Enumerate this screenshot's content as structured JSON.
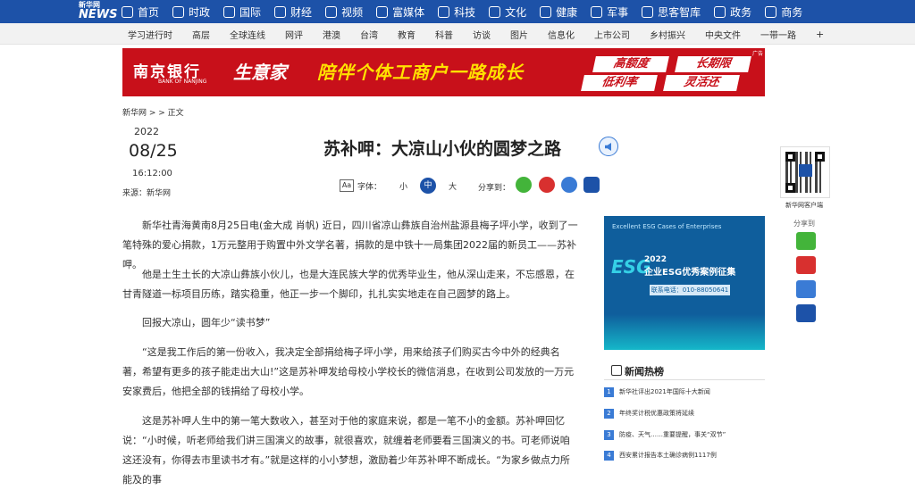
{
  "site": {
    "logo_top": "新华网",
    "logo_main": "NEWS"
  },
  "nav": [
    "首页",
    "时政",
    "国际",
    "财经",
    "视频",
    "富媒体",
    "科技",
    "文化",
    "健康",
    "军事",
    "思客智库",
    "政务",
    "商务"
  ],
  "subnav": [
    "学习进行时",
    "高层",
    "全球连线",
    "网评",
    "港澳",
    "台湾",
    "教育",
    "科普",
    "访谈",
    "图片",
    "信息化",
    "上市公司",
    "乡村振兴",
    "中央文件",
    "一带一路"
  ],
  "subnav_more": "+",
  "banner": {
    "bank_name": "南京银行",
    "bank_en": "BANK OF NANJING",
    "biz": "生意家",
    "slogan": "陪伴个体工商户一路成长",
    "tags": [
      "高额度",
      "长期限",
      "低利率",
      "灵活还"
    ],
    "ad": "广告"
  },
  "breadcrumb": "新华网 > > 正文",
  "date": {
    "year": "2022",
    "monthday": "08/25",
    "time": "16:12:00",
    "source": "来源：新华网"
  },
  "title": "苏补呷：大凉山小伙的圆梦之路",
  "tools": {
    "font_icon": "Aa",
    "font_label": "字体：",
    "small": "小",
    "medium": "中",
    "large": "大",
    "share_label": "分享到："
  },
  "paragraphs": [
    "新华社青海黄南8月25日电(金大成 肖帆) 近日，四川省凉山彝族自治州盐源县梅子坪小学，收到了一笔特殊的爱心捐款，1万元整用于购置中外文学名著，捐款的是中铁十一局集团2022届的新员工——苏补呷。",
    "他是土生土长的大凉山彝族小伙儿，也是大连民族大学的优秀毕业生，他从深山走来，不忘感恩，在甘青隧道一标项目历练，踏实稳重，他正一步一个脚印，扎扎实实地走在自己圆梦的路上。",
    "回报大凉山，圆年少“读书梦”",
    "“这是我工作后的第一份收入，我决定全部捐给梅子坪小学，用来给孩子们购买古今中外的经典名著，希望有更多的孩子能走出大山!”这是苏补呷发给母校小学校长的微信消息，在收到公司发放的一万元安家费后，他把全部的钱捐给了母校小学。",
    "这是苏补呷人生中的第一笔大数收入，甚至对于他的家庭来说，都是一笔不小的金额。苏补呷回忆说：“小时候，听老师给我们讲三国演义的故事，就很喜欢，就缠着老师要看三国演义的书。可老师说咱这还没有，你得去市里读书才有。”就是这样的小小梦想，激励着少年苏补呷不断成长。“为家乡做点力所能及的事"
  ],
  "qr_label": "新华网客户端",
  "side_share_label": "分享到",
  "esg": {
    "logo": "Excellent ESG Cases of Enterprises",
    "big": "ESG",
    "year": "2022",
    "title": "企业ESG优秀案例征集",
    "phone": "联系电话：010-88050641"
  },
  "hot": {
    "title": "新闻热榜",
    "items": [
      "新华社评出2021年国际十大新闻",
      "年终奖计税优惠政策将延续",
      "防疫、天气……重要提醒，事关“双节”",
      "西安累计报告本土确诊病例1117例",
      "成都发现1例新冠肺炎确诊病例"
    ]
  },
  "colors": {
    "brand": "#1d52a8",
    "banner_red": "#c8101a",
    "slogan_yellow": "#ffe100",
    "wechat": "#43b43a",
    "weibo": "#d8302f",
    "link": "#3a7bd5"
  }
}
